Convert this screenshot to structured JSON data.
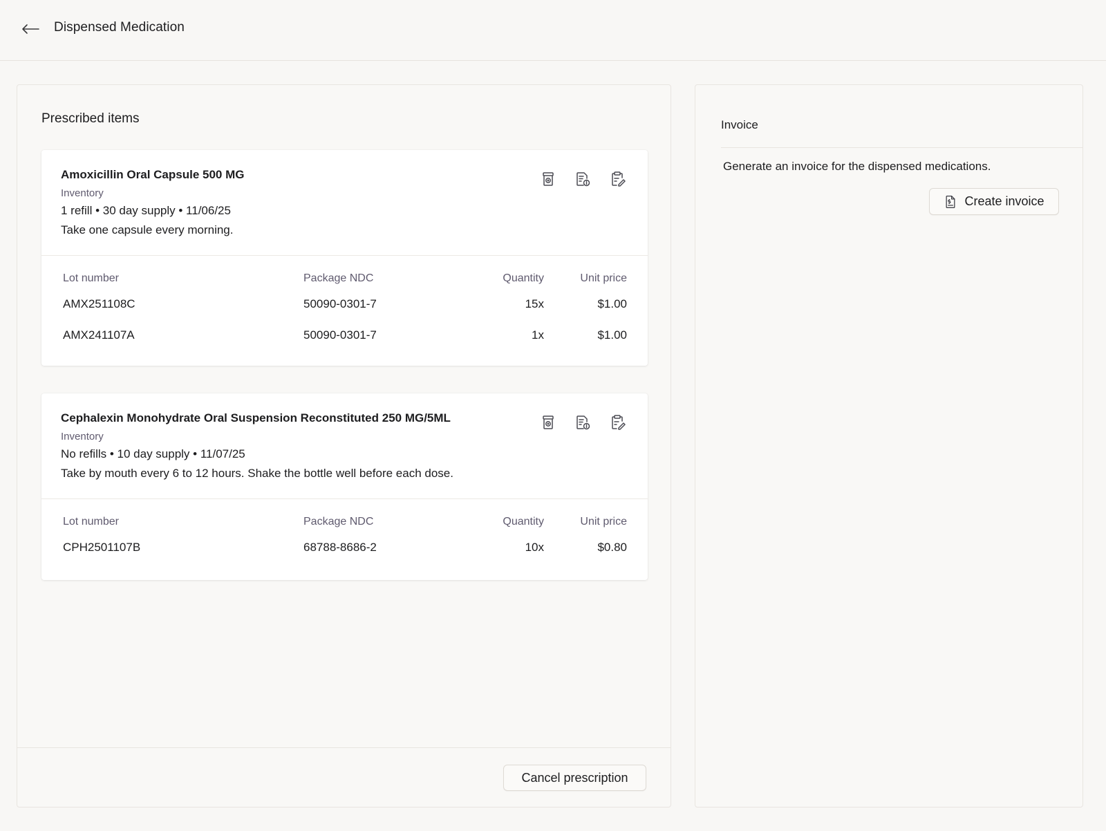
{
  "header": {
    "title": "Dispensed Medication",
    "back_icon": "arrow-left-icon"
  },
  "prescribed": {
    "title": "Prescribed items",
    "columns": {
      "lot": "Lot number",
      "ndc": "Package NDC",
      "qty": "Quantity",
      "price": "Unit price"
    },
    "items": [
      {
        "name": "Amoxicillin Oral Capsule 500 MG",
        "source": "Inventory",
        "details": "1 refill • 30 day supply • 11/06/25",
        "instructions": "Take one capsule every morning.",
        "lots": [
          {
            "lot": "AMX251108C",
            "ndc": "50090-0301-7",
            "qty": "15x",
            "price": "$1.00"
          },
          {
            "lot": "AMX241107A",
            "ndc": "50090-0301-7",
            "qty": "1x",
            "price": "$1.00"
          }
        ]
      },
      {
        "name": "Cephalexin Monohydrate Oral Suspension Reconstituted 250 MG/5ML",
        "source": "Inventory",
        "details": "No refills • 10 day supply • 11/07/25",
        "instructions": "Take by mouth every 6 to 12 hours. Shake the bottle well before each dose.",
        "lots": [
          {
            "lot": "CPH2501107B",
            "ndc": "68788-8686-2",
            "qty": "10x",
            "price": "$0.80"
          }
        ]
      }
    ],
    "cancel_label": "Cancel prescription"
  },
  "invoice": {
    "title": "Invoice",
    "description": "Generate an invoice for the dispensed medications.",
    "create_label": "Create invoice"
  },
  "colors": {
    "background": "#f8f7f5",
    "card": "#ffffff",
    "muted_text": "#5f5a6e",
    "border": "#e8e5e0"
  }
}
